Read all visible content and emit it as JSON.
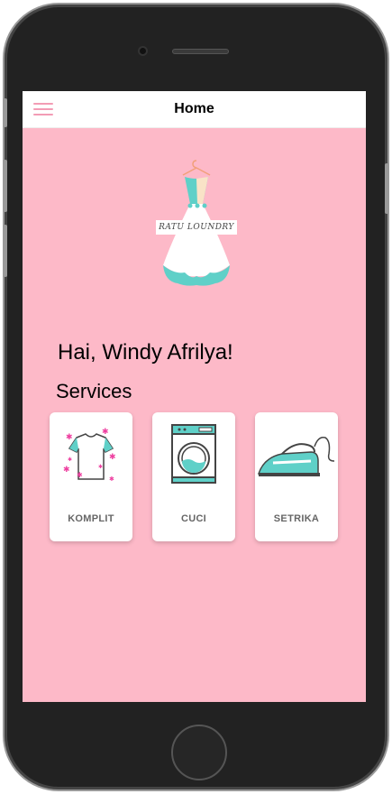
{
  "header": {
    "title": "Home",
    "menu_icon": "hamburger-menu-icon"
  },
  "logo": {
    "text": "RATU LOUNDRY",
    "icon": "dress-logo-icon"
  },
  "greeting": "Hai, Windy Afrilya!",
  "services": {
    "title": "Services",
    "items": [
      {
        "label": "KOMPLIT",
        "icon": "tshirt-icon"
      },
      {
        "label": "CUCI",
        "icon": "washing-machine-icon"
      },
      {
        "label": "SETRIKA",
        "icon": "iron-icon"
      }
    ]
  },
  "colors": {
    "background": "#fdb9c8",
    "accent": "#5fd0c8",
    "menu": "#f39cb5"
  }
}
